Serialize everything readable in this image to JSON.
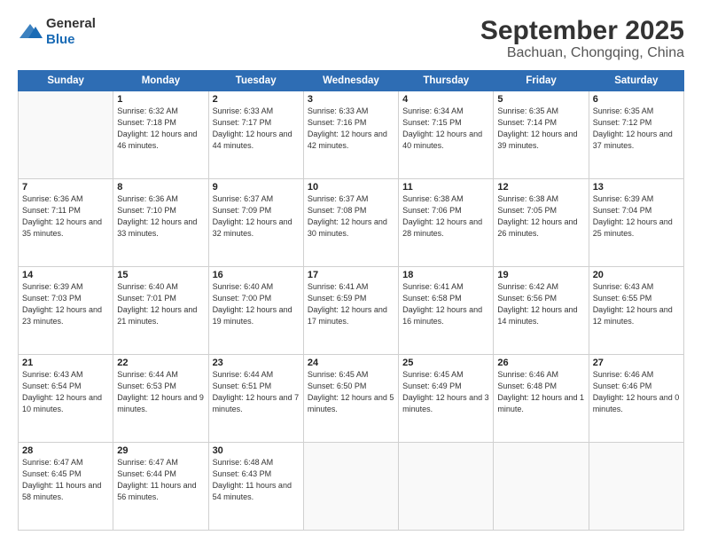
{
  "header": {
    "logo_general": "General",
    "logo_blue": "Blue",
    "month": "September 2025",
    "location": "Bachuan, Chongqing, China"
  },
  "weekdays": [
    "Sunday",
    "Monday",
    "Tuesday",
    "Wednesday",
    "Thursday",
    "Friday",
    "Saturday"
  ],
  "weeks": [
    [
      {
        "day": null
      },
      {
        "day": 1,
        "sunrise": "6:32 AM",
        "sunset": "7:18 PM",
        "daylight": "12 hours and 46 minutes."
      },
      {
        "day": 2,
        "sunrise": "6:33 AM",
        "sunset": "7:17 PM",
        "daylight": "12 hours and 44 minutes."
      },
      {
        "day": 3,
        "sunrise": "6:33 AM",
        "sunset": "7:16 PM",
        "daylight": "12 hours and 42 minutes."
      },
      {
        "day": 4,
        "sunrise": "6:34 AM",
        "sunset": "7:15 PM",
        "daylight": "12 hours and 40 minutes."
      },
      {
        "day": 5,
        "sunrise": "6:35 AM",
        "sunset": "7:14 PM",
        "daylight": "12 hours and 39 minutes."
      },
      {
        "day": 6,
        "sunrise": "6:35 AM",
        "sunset": "7:12 PM",
        "daylight": "12 hours and 37 minutes."
      }
    ],
    [
      {
        "day": 7,
        "sunrise": "6:36 AM",
        "sunset": "7:11 PM",
        "daylight": "12 hours and 35 minutes."
      },
      {
        "day": 8,
        "sunrise": "6:36 AM",
        "sunset": "7:10 PM",
        "daylight": "12 hours and 33 minutes."
      },
      {
        "day": 9,
        "sunrise": "6:37 AM",
        "sunset": "7:09 PM",
        "daylight": "12 hours and 32 minutes."
      },
      {
        "day": 10,
        "sunrise": "6:37 AM",
        "sunset": "7:08 PM",
        "daylight": "12 hours and 30 minutes."
      },
      {
        "day": 11,
        "sunrise": "6:38 AM",
        "sunset": "7:06 PM",
        "daylight": "12 hours and 28 minutes."
      },
      {
        "day": 12,
        "sunrise": "6:38 AM",
        "sunset": "7:05 PM",
        "daylight": "12 hours and 26 minutes."
      },
      {
        "day": 13,
        "sunrise": "6:39 AM",
        "sunset": "7:04 PM",
        "daylight": "12 hours and 25 minutes."
      }
    ],
    [
      {
        "day": 14,
        "sunrise": "6:39 AM",
        "sunset": "7:03 PM",
        "daylight": "12 hours and 23 minutes."
      },
      {
        "day": 15,
        "sunrise": "6:40 AM",
        "sunset": "7:01 PM",
        "daylight": "12 hours and 21 minutes."
      },
      {
        "day": 16,
        "sunrise": "6:40 AM",
        "sunset": "7:00 PM",
        "daylight": "12 hours and 19 minutes."
      },
      {
        "day": 17,
        "sunrise": "6:41 AM",
        "sunset": "6:59 PM",
        "daylight": "12 hours and 17 minutes."
      },
      {
        "day": 18,
        "sunrise": "6:41 AM",
        "sunset": "6:58 PM",
        "daylight": "12 hours and 16 minutes."
      },
      {
        "day": 19,
        "sunrise": "6:42 AM",
        "sunset": "6:56 PM",
        "daylight": "12 hours and 14 minutes."
      },
      {
        "day": 20,
        "sunrise": "6:43 AM",
        "sunset": "6:55 PM",
        "daylight": "12 hours and 12 minutes."
      }
    ],
    [
      {
        "day": 21,
        "sunrise": "6:43 AM",
        "sunset": "6:54 PM",
        "daylight": "12 hours and 10 minutes."
      },
      {
        "day": 22,
        "sunrise": "6:44 AM",
        "sunset": "6:53 PM",
        "daylight": "12 hours and 9 minutes."
      },
      {
        "day": 23,
        "sunrise": "6:44 AM",
        "sunset": "6:51 PM",
        "daylight": "12 hours and 7 minutes."
      },
      {
        "day": 24,
        "sunrise": "6:45 AM",
        "sunset": "6:50 PM",
        "daylight": "12 hours and 5 minutes."
      },
      {
        "day": 25,
        "sunrise": "6:45 AM",
        "sunset": "6:49 PM",
        "daylight": "12 hours and 3 minutes."
      },
      {
        "day": 26,
        "sunrise": "6:46 AM",
        "sunset": "6:48 PM",
        "daylight": "12 hours and 1 minute."
      },
      {
        "day": 27,
        "sunrise": "6:46 AM",
        "sunset": "6:46 PM",
        "daylight": "12 hours and 0 minutes."
      }
    ],
    [
      {
        "day": 28,
        "sunrise": "6:47 AM",
        "sunset": "6:45 PM",
        "daylight": "11 hours and 58 minutes."
      },
      {
        "day": 29,
        "sunrise": "6:47 AM",
        "sunset": "6:44 PM",
        "daylight": "11 hours and 56 minutes."
      },
      {
        "day": 30,
        "sunrise": "6:48 AM",
        "sunset": "6:43 PM",
        "daylight": "11 hours and 54 minutes."
      },
      {
        "day": null
      },
      {
        "day": null
      },
      {
        "day": null
      },
      {
        "day": null
      }
    ]
  ]
}
